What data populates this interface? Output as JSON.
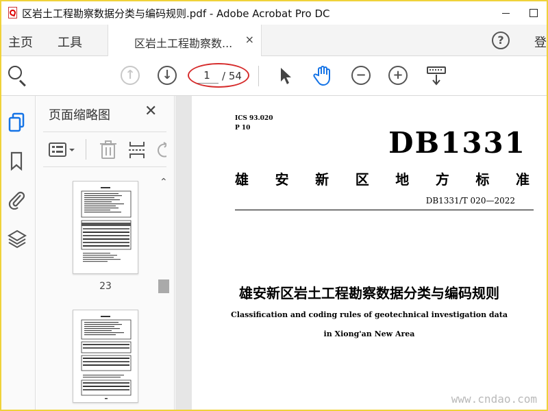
{
  "window": {
    "title": "区岩土工程勘察数据分类与编码规则.pdf - Adobe Acrobat Pro DC"
  },
  "tabbar": {
    "home": "主页",
    "tools": "工具",
    "doc_tab": "区岩土工程勘察数...",
    "doc_tab_close": "×",
    "help": "?",
    "login": "登"
  },
  "toolbar": {
    "current_page": "1",
    "total_pages": "/ 54"
  },
  "thumbnails_panel": {
    "title": "页面缩略图",
    "close": "✕",
    "pages": [
      {
        "label": "23"
      },
      {
        "label": ""
      }
    ]
  },
  "document": {
    "ics": "ICS 93.020",
    "p_code": "P 10",
    "db_code": "DB1331",
    "local_standard_chars": [
      "雄",
      "安",
      "新",
      "区",
      "地",
      "方",
      "标",
      "准"
    ],
    "standard_number": "DB1331/T 020—2022",
    "title_cn": "雄安新区岩土工程勘察数据分类与编码规则",
    "title_en_line1": "Classification and coding rules of geotechnical investigation data",
    "title_en_line2": "in Xiong'an New Area"
  },
  "watermark": "www.cndao.com",
  "colors": {
    "outer_border": "#f0d23a",
    "annotation_ellipse": "#d62c2c",
    "hand_tool_active": "#1473e6",
    "rail_active": "#1473e6"
  }
}
